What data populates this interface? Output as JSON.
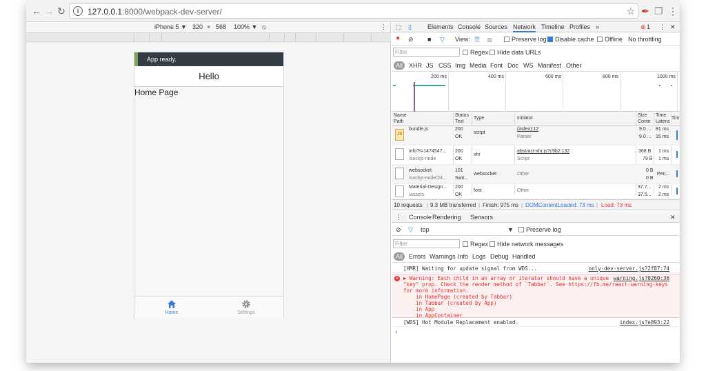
{
  "browser": {
    "url_host": "127.0.0.1",
    "url_path": ":8000/webpack-dev-server/"
  },
  "device_toolbar": {
    "device": "iPhone 5 ▼",
    "width": "320",
    "times": "×",
    "height": "568",
    "zoom": "100% ▼"
  },
  "app": {
    "toast": "App ready.",
    "title": "Hello",
    "page_text": "Home Page",
    "tabs": [
      {
        "label": "Home",
        "active": true
      },
      {
        "label": "Settings",
        "active": false
      }
    ],
    "accent": "#3879d9"
  },
  "devtools": {
    "tabs": [
      "Elements",
      "Console",
      "Sources",
      "Network",
      "Timeline",
      "Profiles",
      "»"
    ],
    "active_tab": "Network",
    "error_count": "1",
    "network_toolbar": {
      "view_label": "View:",
      "preserve_log": "Preserve log",
      "disable_cache": "Disable cache",
      "offline": "Offline",
      "throttling": "No throttling"
    },
    "filter": {
      "placeholder": "Filter",
      "regex": "Regex",
      "hide_data_urls": "Hide data URLs"
    },
    "types": [
      "All",
      "XHR",
      "JS",
      "CSS",
      "Img",
      "Media",
      "Font",
      "Doc",
      "WS",
      "Manifest",
      "Other"
    ],
    "timeline_ticks": [
      "200 ms",
      "400 ms",
      "600 ms",
      "800 ms",
      "1000 ms"
    ],
    "columns": {
      "name": "Name",
      "path": "Path",
      "status": "Status",
      "text": "Text",
      "type": "Type",
      "initiator": "Initiator",
      "size": "Size",
      "content": "Conte",
      "time": "Time",
      "latency": "Latenc",
      "timeline": "Tim"
    },
    "requests": [
      {
        "name": "bundle.js",
        "path": "",
        "status": "200",
        "text": "OK",
        "type": "script",
        "initiator": "(index):12",
        "initiator_sub": "Parser",
        "size": "9.0 ...",
        "content": "9.0 ...",
        "time": "81 ms",
        "latency": "15 ms"
      },
      {
        "name": "info?t=1474547...",
        "path": "/sockjs-node",
        "status": "200",
        "text": "OK",
        "type": "xhr",
        "initiator": "abstract-xhr.js?c9b2:132",
        "initiator_sub": "Script",
        "size": "368 B",
        "content": "79 B",
        "time": "1 ms",
        "latency": "1 ms"
      },
      {
        "name": "websocket",
        "path": "/sockjs-node/24...",
        "status": "101",
        "text": "Swit...",
        "type": "websocket",
        "initiator": "Other",
        "initiator_sub": "",
        "size": "0 B",
        "content": "0 B",
        "time": "Pen...",
        "latency": ""
      },
      {
        "name": "Material-Design...",
        "path": "/assets",
        "status": "200",
        "text": "OK",
        "type": "font",
        "initiator": "Other",
        "initiator_sub": "",
        "size": "37.7...",
        "content": "37.5...",
        "time": "2 ms",
        "latency": "2 ms"
      }
    ],
    "summary": {
      "requests": "10 requests",
      "transferred": "9.3 MB transferred",
      "finish": "Finish: 975 ms",
      "dcl": "DOMContentLoaded: 73 ms",
      "load": "Load: 73 ms"
    },
    "drawer_tabs": [
      "Console",
      "Rendering",
      "Sensors"
    ],
    "console": {
      "context": "top",
      "preserve_log": "Preserve log",
      "filter_placeholder": "Filter",
      "regex": "Regex",
      "hide_network": "Hide network messages",
      "levels": [
        "All",
        "Errors",
        "Warnings",
        "Info",
        "Logs",
        "Debug",
        "Handled"
      ],
      "messages": [
        {
          "kind": "log",
          "text": "[HMR] Waiting for update signal from WDS...",
          "source": "only-dev-server.js?2f87:74"
        },
        {
          "kind": "warning",
          "text": "▶ Warning: Each child in an array or iterator should have a unique\n\"key\" prop. Check the render method of `Tabbar`. See https://fb.me/react-warning-keys\nfor more information.\n    in HomePage (created by Tabbar)\n    in Tabbar (created by App)\n    in App\n    in AppContainer",
          "source": "warning.js?0260:36"
        },
        {
          "kind": "log",
          "text": "[WDS] Hot Module Replacement enabled.",
          "source": "index.js?e893:22"
        }
      ],
      "prompt": "›"
    }
  }
}
